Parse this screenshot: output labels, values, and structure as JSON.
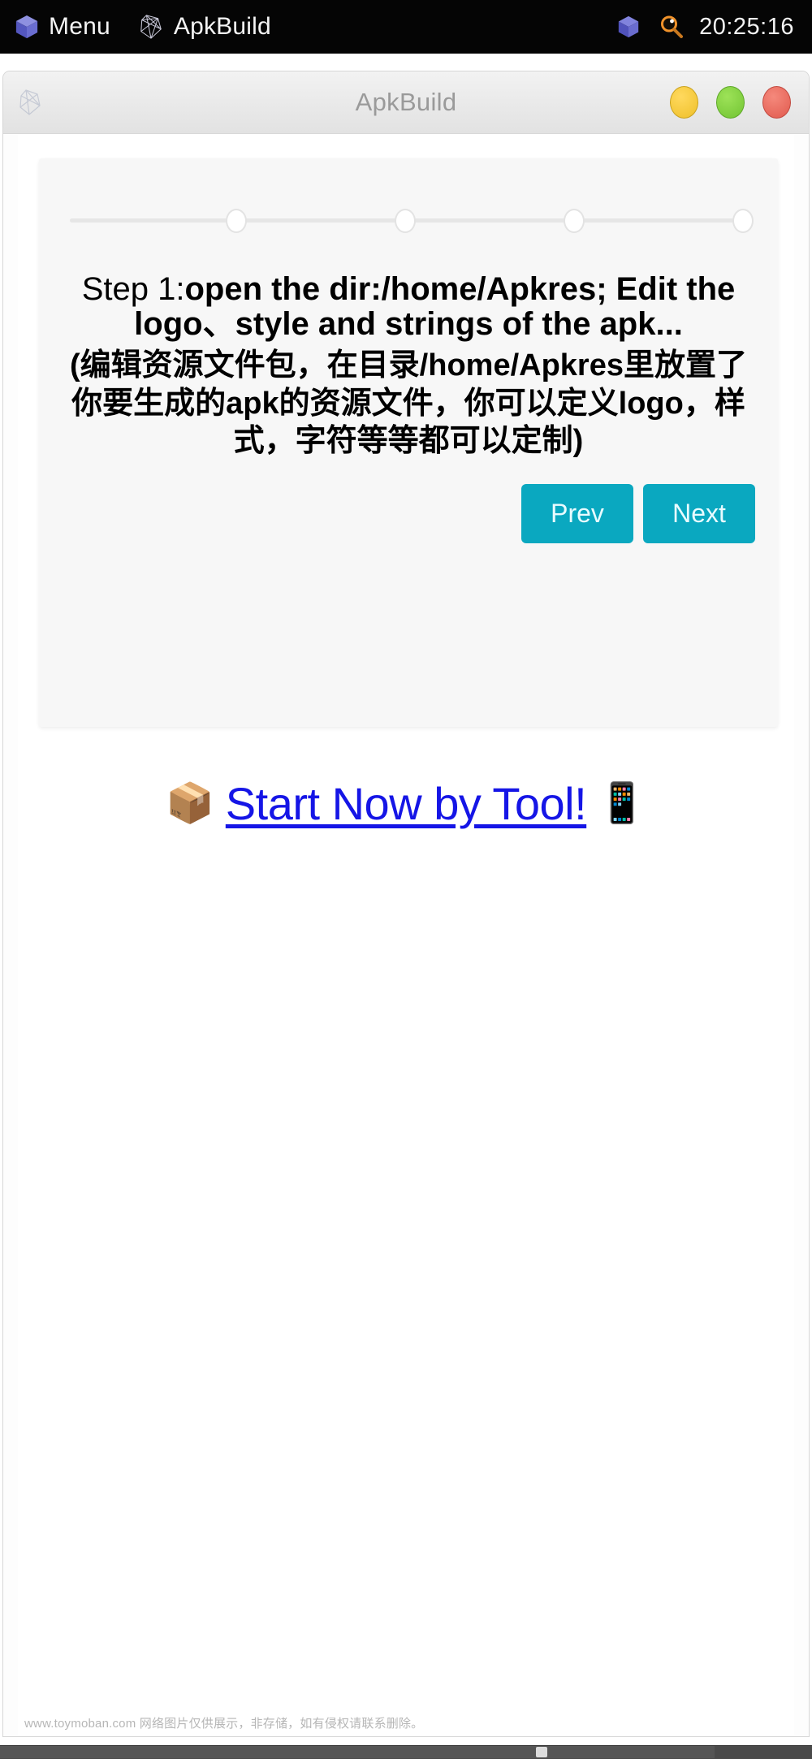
{
  "desktop": {
    "panel": {
      "menu_label": "Menu",
      "app_label": "ApkBuild",
      "clock": "20:25:16",
      "icons": {
        "menu": "cube-icon",
        "app": "wireframe-polyhedron-icon",
        "tray_cube": "cube-icon",
        "tray_search": "magnifier-icon"
      }
    }
  },
  "window": {
    "title": "ApkBuild",
    "icon": "wireframe-polyhedron-icon",
    "buttons": {
      "minimize": "minimize-button",
      "maximize": "maximize-button",
      "close": "close-button"
    },
    "colors": {
      "minimize": "#efc02a",
      "maximize": "#72c433",
      "close": "#e15a4e"
    }
  },
  "page": {
    "stepper": {
      "steps": 4,
      "current": 1
    },
    "step": {
      "label": "Step 1:",
      "english": "open the dir:/home/Apkres; Edit the logo、style and strings of the apk...",
      "chinese": "(编辑资源文件包，在目录/home/Apkres里放置了你要生成的apk的资源文件，你可以定义logo，样式，字符等等都可以定制)"
    },
    "buttons": {
      "prev": "Prev",
      "next": "Next",
      "accent": "#0aa8c0"
    },
    "link": {
      "package_emoji": "📦",
      "text": "Start Now by Tool!",
      "phone_emoji": "📱",
      "color": "#1515e6"
    }
  },
  "watermark": "www.toymoban.com 网络图片仅供展示，非存储，如有侵权请联系删除。"
}
